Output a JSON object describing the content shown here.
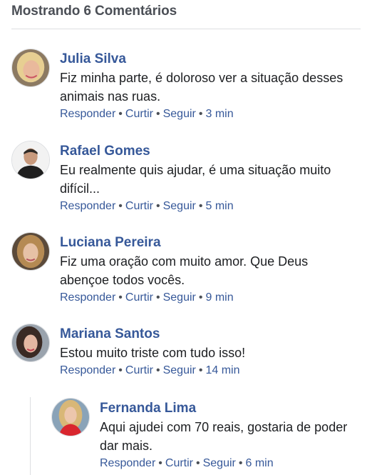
{
  "header": {
    "title": "Mostrando 6 Comentários"
  },
  "actions": {
    "reply": "Responder",
    "like": "Curtir",
    "follow": "Seguir"
  },
  "comments": [
    {
      "name": "Julia Silva",
      "text": "Fiz minha parte, é doloroso ver a situação desses animais nas ruas.",
      "time": "3 min"
    },
    {
      "name": "Rafael Gomes",
      "text": "Eu realmente quis ajudar, é uma situação muito difícil...",
      "time": "5 min"
    },
    {
      "name": "Luciana Pereira",
      "text": "Fiz uma oração com muito amor. Que Deus abençoe todos vocês.",
      "time": "9 min"
    },
    {
      "name": "Mariana Santos",
      "text": "Estou muito triste com tudo isso!",
      "time": "14 min"
    },
    {
      "name": "Fernanda Lima",
      "text": "Aqui ajudei com 70 reais, gostaria de poder dar mais.",
      "time": "6 min"
    }
  ]
}
